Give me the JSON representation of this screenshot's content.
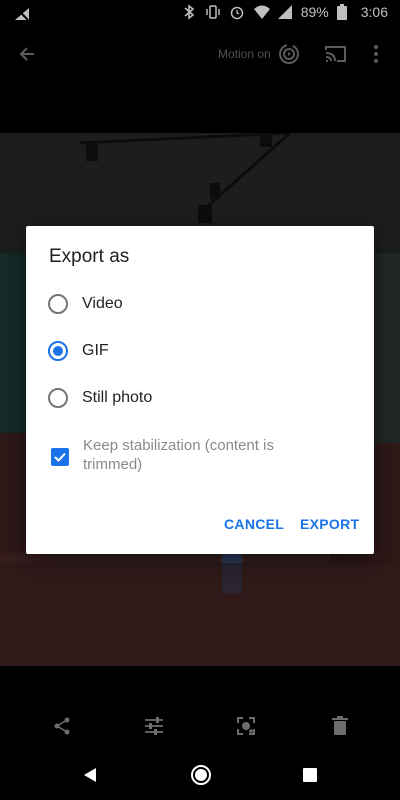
{
  "status_bar": {
    "battery": "89%",
    "time": "3:06",
    "icons": [
      "no-signal-icon",
      "bluetooth-icon",
      "vibrate-icon",
      "alarm-icon",
      "wifi-icon",
      "cellular-icon",
      "battery-icon"
    ]
  },
  "app_bar": {
    "back_icon": "arrow-left-icon",
    "motion_label": "Motion on",
    "motion_icon": "motion-photo-icon",
    "cast_icon": "cast-icon",
    "more_icon": "more-vert-icon"
  },
  "dialog": {
    "title": "Export as",
    "options": [
      {
        "label": "Video",
        "selected": false
      },
      {
        "label": "GIF",
        "selected": true
      },
      {
        "label": "Still photo",
        "selected": false
      }
    ],
    "stabilization": {
      "label": "Keep stabilization (content is trimmed)",
      "checked": true
    },
    "cancel_label": "CANCEL",
    "export_label": "EXPORT",
    "accent_color": "#1a73e8"
  },
  "bottom_actions": [
    "share-icon",
    "edit-adjust-icon",
    "lens-icon",
    "delete-icon"
  ],
  "nav_bar": [
    "back-nav-icon",
    "home-nav-icon",
    "recents-nav-icon"
  ]
}
